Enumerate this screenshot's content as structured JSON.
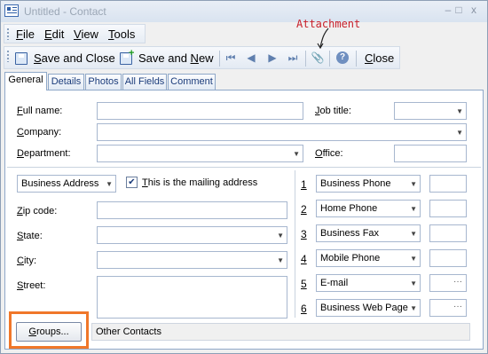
{
  "window": {
    "title": "Untitled - Contact",
    "controls": {
      "minimize": "–",
      "maximize": "□",
      "close": "x"
    }
  },
  "annotation": {
    "text": "Attachment",
    "color": "#c8202a"
  },
  "menu": {
    "file": {
      "key": "F",
      "rest": "ile"
    },
    "edit": {
      "key": "E",
      "rest": "dit"
    },
    "view": {
      "key": "V",
      "rest": "iew"
    },
    "tools": {
      "key": "T",
      "rest": "ools"
    }
  },
  "toolbar": {
    "save_close": {
      "key": "S",
      "rest": "ave and Close"
    },
    "save_new": {
      "prefix": "Save and ",
      "key": "N",
      "rest": "ew"
    },
    "first": "⏮",
    "prev": "◀",
    "next": "▶",
    "last": "⏭",
    "attachment": "📎",
    "help": "?",
    "close": {
      "key": "C",
      "rest": "lose"
    }
  },
  "tabs": [
    "General",
    "Details",
    "Photos",
    "All Fields",
    "Comment"
  ],
  "general": {
    "full_name": {
      "key": "F",
      "rest": "ull name:",
      "value": ""
    },
    "job_title": {
      "key": "J",
      "rest": "ob title:",
      "value": ""
    },
    "company": {
      "key": "C",
      "rest": "ompany:",
      "value": ""
    },
    "department": {
      "key": "D",
      "rest": "epartment:",
      "value": ""
    },
    "office": {
      "key": "O",
      "rest": "ffice:",
      "value": ""
    }
  },
  "address": {
    "type": "Business Address",
    "mailing_checkbox": {
      "checked": "✔",
      "key": "T",
      "rest": "his is the mailing address"
    },
    "zip": {
      "key": "Z",
      "rest": "ip code:",
      "value": ""
    },
    "state": {
      "key": "S",
      "rest": "tate:",
      "value": ""
    },
    "city": {
      "key": "C",
      "rest": "ity:",
      "value": ""
    },
    "street": {
      "key": "S",
      "rest": "treet:",
      "value": ""
    }
  },
  "phones": [
    {
      "num": "1",
      "type": "Business Phone",
      "value": ""
    },
    {
      "num": "2",
      "type": "Home Phone",
      "value": ""
    },
    {
      "num": "3",
      "type": "Business Fax",
      "value": ""
    },
    {
      "num": "4",
      "type": "Mobile Phone",
      "value": ""
    },
    {
      "num": "5",
      "type": "E-mail",
      "value": "",
      "dots": "···"
    },
    {
      "num": "6",
      "type": "Business Web Page",
      "value": "",
      "dots": "···"
    }
  ],
  "groups": {
    "button_key": "G",
    "button_rest": "roups...",
    "value": "Other Contacts"
  },
  "colors": {
    "highlight": "#f0772a",
    "tab_text": "#1a3b7a"
  }
}
